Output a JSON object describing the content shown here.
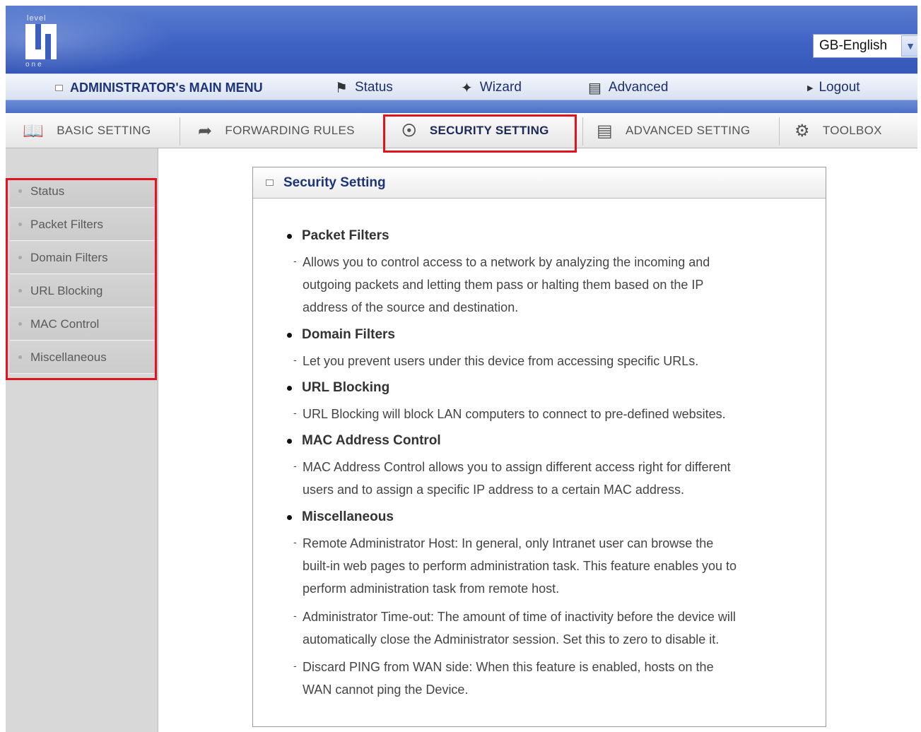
{
  "header": {
    "logo_top": "level",
    "logo_bottom": "one",
    "language_selected": "GB-English"
  },
  "menubar": {
    "title": "ADMINISTRATOR's MAIN MENU",
    "status": "Status",
    "wizard": "Wizard",
    "advanced": "Advanced",
    "logout": "Logout"
  },
  "tabs": [
    {
      "label": "BASIC SETTING",
      "icon": "book-icon"
    },
    {
      "label": "FORWARDING RULES",
      "icon": "arrow-icon"
    },
    {
      "label": "SECURITY SETTING",
      "icon": "shield-icon",
      "active": true
    },
    {
      "label": "ADVANCED SETTING",
      "icon": "advanced-icon"
    },
    {
      "label": "TOOLBOX",
      "icon": "toolbox-icon"
    }
  ],
  "sidebar": {
    "items": [
      {
        "label": "Status"
      },
      {
        "label": "Packet Filters"
      },
      {
        "label": "Domain Filters"
      },
      {
        "label": "URL Blocking"
      },
      {
        "label": "MAC Control"
      },
      {
        "label": "Miscellaneous"
      }
    ]
  },
  "panel": {
    "title": "Security Setting",
    "sections": [
      {
        "title": "Packet Filters",
        "desc": [
          [
            "Allows you to control access to a network by analyzing the incoming and",
            "outgoing packets and letting them pass or halting them based on the IP",
            "address of the source and destination."
          ]
        ]
      },
      {
        "title": "Domain Filters",
        "desc": [
          [
            "Let you prevent users under this device from accessing specific URLs."
          ]
        ]
      },
      {
        "title": "URL Blocking",
        "desc": [
          [
            "URL Blocking will block LAN computers to connect to pre-defined websites."
          ]
        ]
      },
      {
        "title": "MAC Address Control",
        "desc": [
          [
            "MAC Address Control allows you to assign different access right for different",
            "users and to assign a specific IP address to a certain MAC address."
          ]
        ]
      },
      {
        "title": "Miscellaneous",
        "desc": [
          [
            "Remote Administrator Host: In general, only Intranet user can browse the",
            "built-in web pages to perform administration task. This feature enables you to",
            "perform administration task from remote host."
          ],
          [
            "Administrator Time-out: The amount of time of inactivity before the device will",
            "automatically close the Administrator session. Set this to zero to disable it."
          ],
          [
            "Discard PING from WAN side: When this feature is enabled, hosts on the",
            "WAN cannot ping the Device."
          ]
        ]
      }
    ]
  },
  "colors": {
    "banner": "#3f63c4",
    "highlight": "#e0141e",
    "title_blue": "#1d3479"
  }
}
